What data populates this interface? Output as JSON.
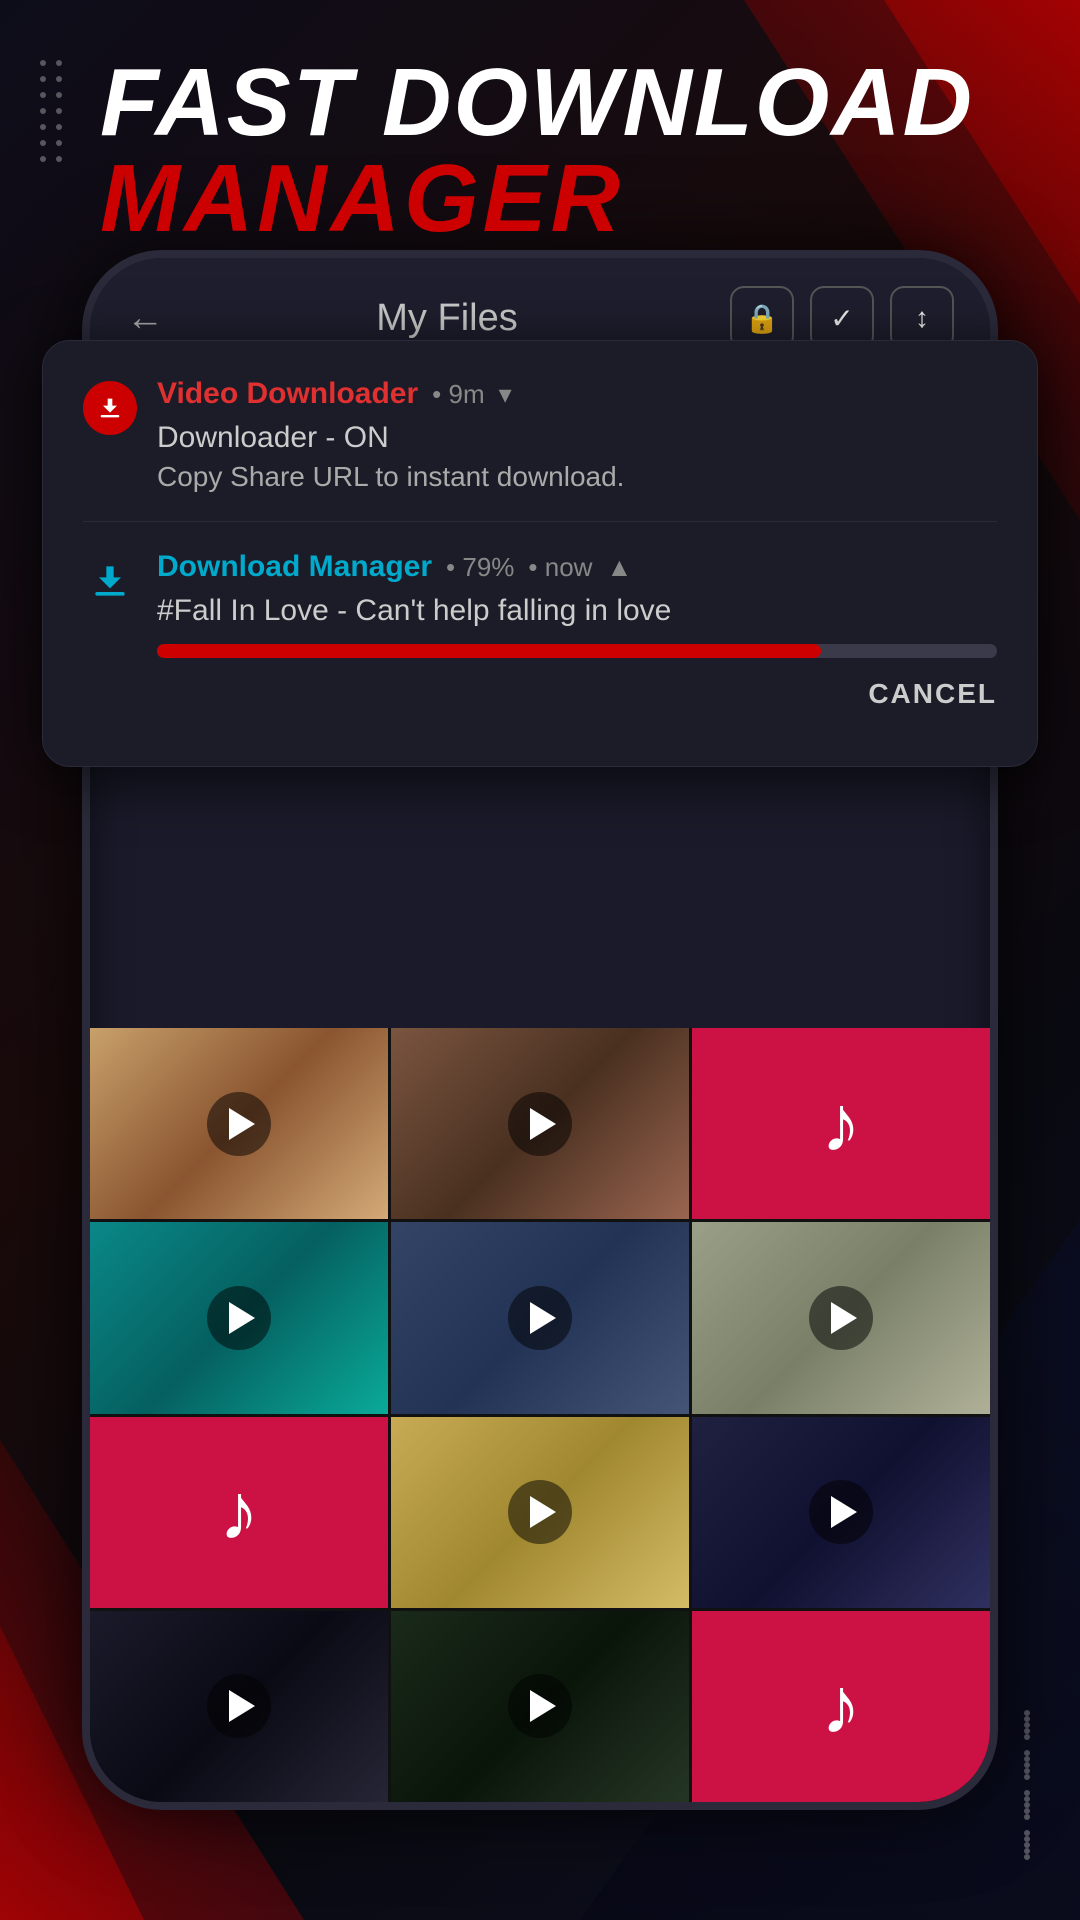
{
  "app": {
    "title": "Fast Download Manager",
    "title_line1": "FAST DOWNLOAD",
    "title_line2": "MANAGER"
  },
  "phone": {
    "topbar": {
      "back": "←",
      "title": "My Files",
      "icon1": "🔒",
      "icon2": "✓",
      "icon3": "↕"
    }
  },
  "notification1": {
    "app_name": "Video Downloader",
    "time": "• 9m",
    "chevron": "▾",
    "title": "Downloader - ON",
    "subtitle": "Copy Share URL to instant download."
  },
  "notification2": {
    "app_name": "Download Manager",
    "time": "• 79%",
    "time2": "• now",
    "chevron": "▲",
    "filename": "#Fall In Love - Can't help falling in love",
    "progress_pct": 79,
    "cancel_label": "CANCEL"
  },
  "dots": {
    "left_rows": 5,
    "left_cols": 2,
    "bottom_rows": 4,
    "bottom_cols": 5
  },
  "grid": {
    "cells": [
      {
        "type": "video",
        "style": "img-1"
      },
      {
        "type": "video",
        "style": "img-2"
      },
      {
        "type": "music"
      },
      {
        "type": "video",
        "style": "img-3"
      },
      {
        "type": "video",
        "style": "img-4"
      },
      {
        "type": "video",
        "style": "img-5"
      },
      {
        "type": "music"
      },
      {
        "type": "video",
        "style": "img-6"
      },
      {
        "type": "video",
        "style": "img-7"
      },
      {
        "type": "video",
        "style": "sunglass-1"
      },
      {
        "type": "video",
        "style": "sunglass-2"
      },
      {
        "type": "music"
      }
    ]
  }
}
